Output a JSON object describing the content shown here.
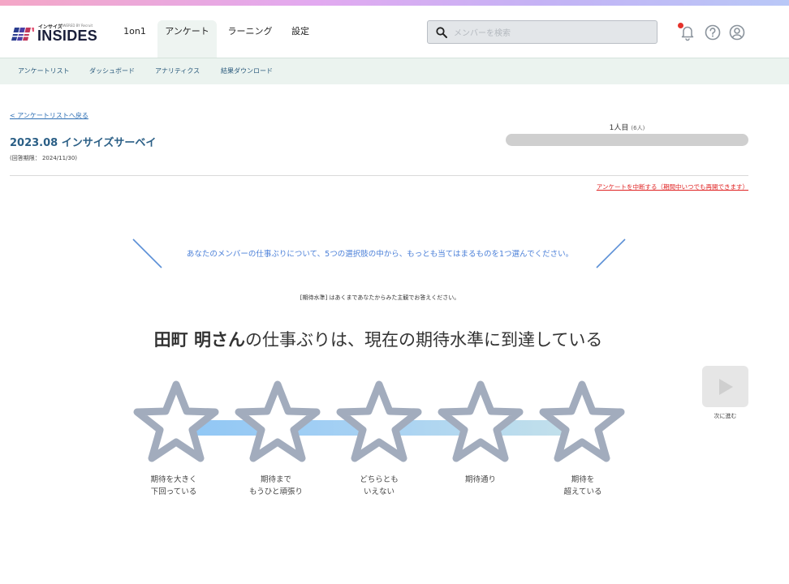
{
  "brand": {
    "logo_text": "INSIDES",
    "logo_small": "インサイズ",
    "logo_sub": "POWERED BY Recruit"
  },
  "nav": {
    "items": [
      {
        "label": "1on1"
      },
      {
        "label": "アンケート",
        "active": true
      },
      {
        "label": "ラーニング"
      },
      {
        "label": "設定"
      }
    ]
  },
  "search": {
    "placeholder": "メンバーを検索",
    "value": ""
  },
  "header_icons": [
    "bell-icon",
    "help-icon",
    "user-icon"
  ],
  "subnav": {
    "items": [
      {
        "label": "アンケートリスト"
      },
      {
        "label": "ダッシュボード"
      },
      {
        "label": "アナリティクス"
      },
      {
        "label": "結果ダウンロード"
      }
    ]
  },
  "page": {
    "back_link": "< アンケートリストへ戻る",
    "title": "2023.08 インサイズサーベイ",
    "deadline": "(回答期限： 2024/11/30)",
    "progress_current": "1人目",
    "progress_total": "(6人)",
    "progress_fraction": 0.0,
    "pause_link": "アンケートを中断する（期間中いつでも再開できます）"
  },
  "survey": {
    "instruction": "あなたのメンバーの仕事ぶりについて、5つの選択肢の中から、もっとも当てはまるものを1つ選んでください。",
    "note": "[期待水準] はあくまであなたからみた主観でお答えください。",
    "question_name": "田町 明さん",
    "question_text": "の仕事ぶりは、現在の期待水準に到達している",
    "options": [
      {
        "line1": "期待を大きく",
        "line2": "下回っている"
      },
      {
        "line1": "期待まで",
        "line2": "もうひと頑張り"
      },
      {
        "line1": "どちらとも",
        "line2": "いえない"
      },
      {
        "line1": "期待通り",
        "line2": ""
      },
      {
        "line1": "期待を",
        "line2": "超えている"
      }
    ],
    "next_label": "次に進む"
  },
  "colors": {
    "accent": "#2b5f86",
    "instruction": "#4a7fd8",
    "star_outline": "#a2acbd",
    "alert": "#e02424"
  }
}
